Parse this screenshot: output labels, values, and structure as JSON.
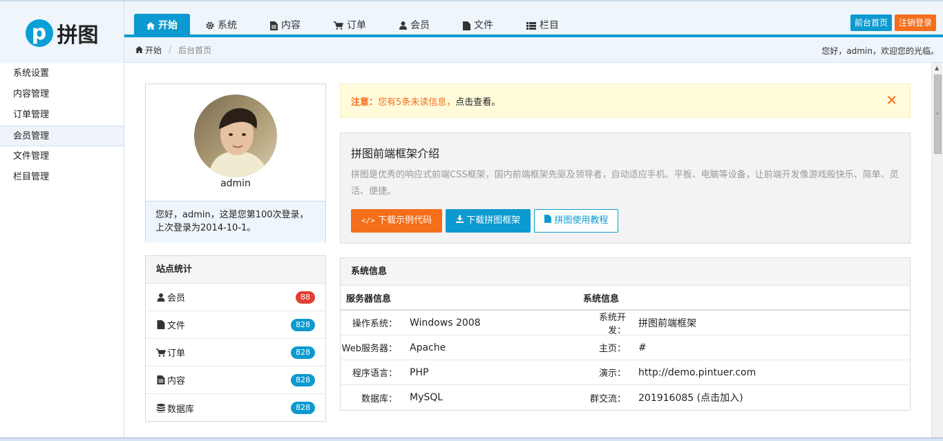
{
  "brand": {
    "logo_letter": "p",
    "name": "拼图"
  },
  "nav": {
    "tabs": [
      {
        "label": "开始",
        "icon": "home-icon"
      },
      {
        "label": "系统",
        "icon": "gear-icon"
      },
      {
        "label": "内容",
        "icon": "file-text-icon"
      },
      {
        "label": "订单",
        "icon": "cart-icon"
      },
      {
        "label": "会员",
        "icon": "user-icon"
      },
      {
        "label": "文件",
        "icon": "file-icon"
      },
      {
        "label": "栏目",
        "icon": "list-icon"
      }
    ],
    "active": "开始"
  },
  "header_buttons": {
    "home": "前台首页",
    "logout": "注销登录"
  },
  "breadcrumb": {
    "root": "开始",
    "current": "后台首页",
    "welcome": "您好，admin，欢迎您的光临。"
  },
  "sidebar": {
    "items": [
      {
        "label": "系统设置"
      },
      {
        "label": "内容管理"
      },
      {
        "label": "订单管理"
      },
      {
        "label": "会员管理"
      },
      {
        "label": "文件管理"
      },
      {
        "label": "栏目管理"
      }
    ],
    "active": "会员管理"
  },
  "profile": {
    "name": "admin",
    "login_info": "您好，admin，这是您第100次登录，上次登录为2014-10-1。"
  },
  "stats": {
    "title": "站点统计",
    "rows": [
      {
        "label": "会员",
        "count": "88",
        "icon": "user-icon"
      },
      {
        "label": "文件",
        "count": "828",
        "icon": "file-icon"
      },
      {
        "label": "订单",
        "count": "828",
        "icon": "cart-icon"
      },
      {
        "label": "内容",
        "count": "828",
        "icon": "file-text-icon"
      },
      {
        "label": "数据库",
        "count": "828",
        "icon": "database-icon"
      }
    ]
  },
  "notice": {
    "prefix": "注意：",
    "highlight": "您有5条未读信息，",
    "suffix": "点击查看。"
  },
  "intro": {
    "title": "拼图前端框架介绍",
    "text": "拼图是优秀的响应式前端CSS框架，国内前端框架先驱及领导者，自动适应手机、平板、电脑等设备，让前端开发像游戏般快乐、简单、灵活、便捷。",
    "buttons": {
      "download_demo": "下载示例代码",
      "download_framework": "下载拼图框架",
      "tutorial": "拼图使用教程"
    }
  },
  "system": {
    "title": "系统信息",
    "col1_header": "服务器信息",
    "col2_header": "系统信息",
    "rows": [
      {
        "k1": "操作系统：",
        "v1": "Windows 2008",
        "k2": "系统开发：",
        "v2": "拼图前端框架"
      },
      {
        "k1": "Web服务器：",
        "v1": "Apache",
        "k2": "主页：",
        "v2": "#"
      },
      {
        "k1": "程序语言：",
        "v1": "PHP",
        "k2": "演示：",
        "v2": "http://demo.pintuer.com"
      },
      {
        "k1": "数据库：",
        "v1": "MySQL",
        "k2": "群交流：",
        "v2": "201916085 (点击加入)"
      }
    ]
  },
  "colors": {
    "primary": "#0c9ad0",
    "orange": "#f56e1a",
    "red": "#e33e33",
    "notice_bg": "#fffbdb"
  }
}
